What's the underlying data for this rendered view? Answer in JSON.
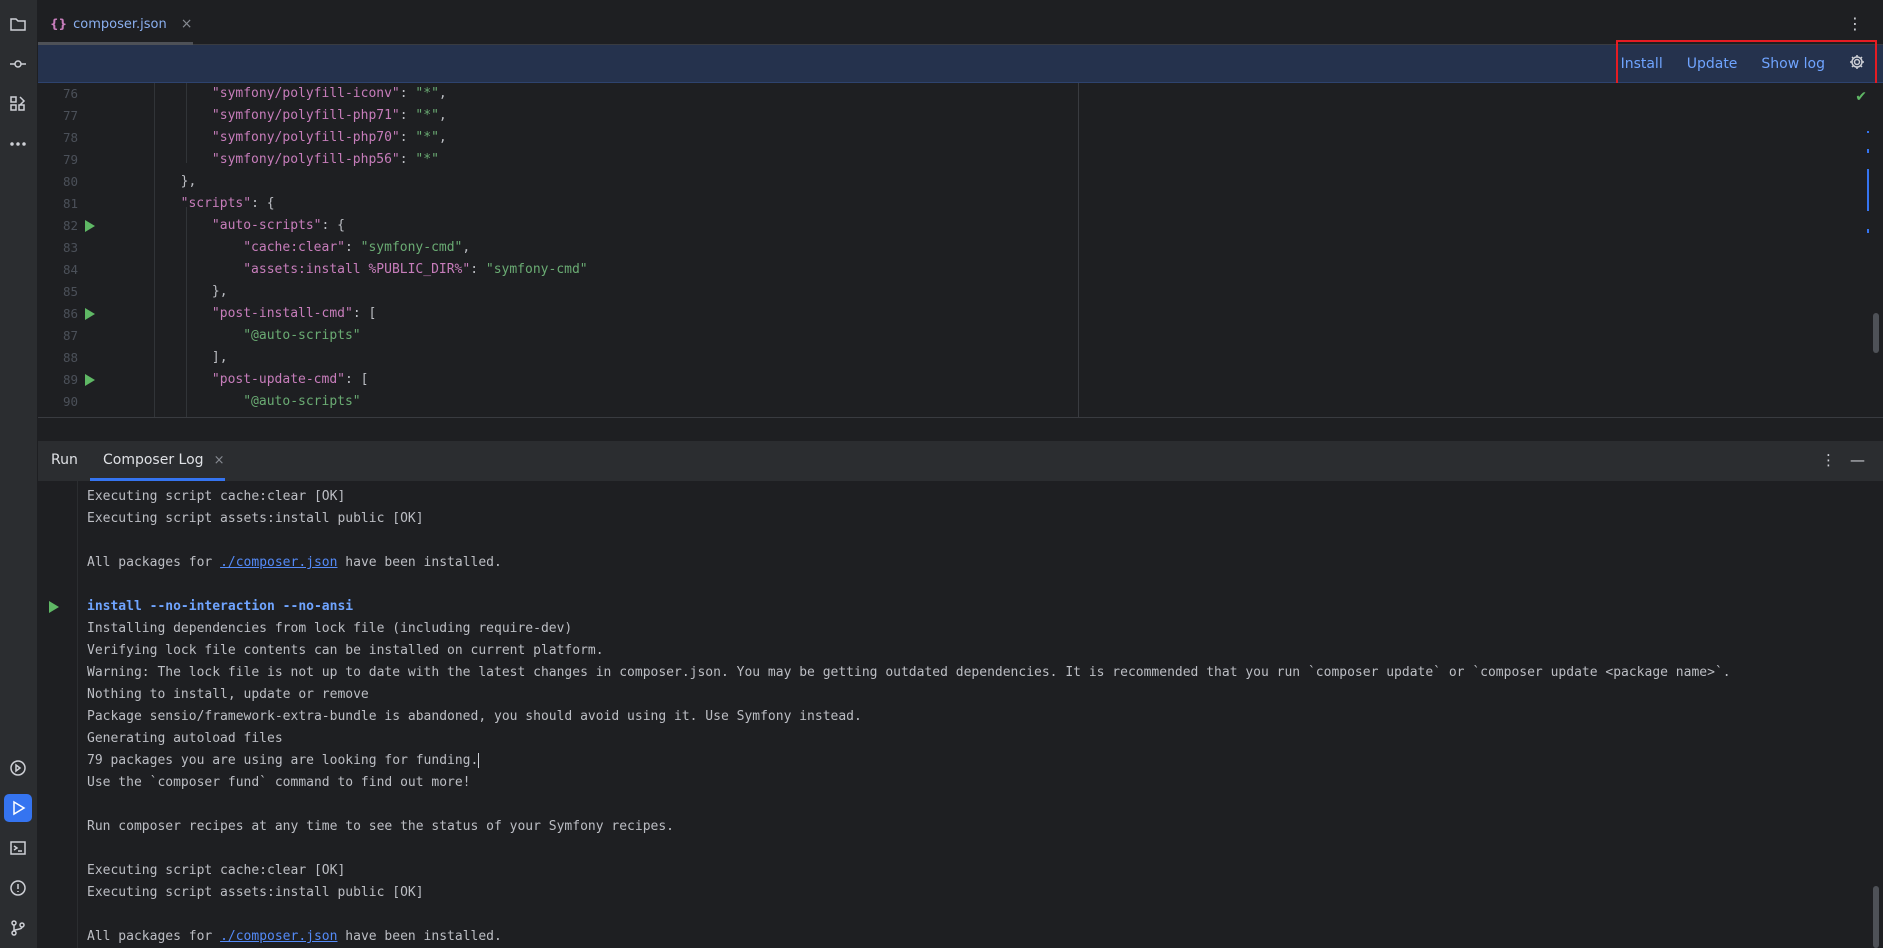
{
  "sidebar": {
    "top_icons": [
      {
        "icon": "folder-icon"
      },
      {
        "icon": "commit-icon"
      },
      {
        "icon": "structure-icon"
      },
      {
        "icon": "more-icon"
      }
    ],
    "bottom_icons": [
      {
        "icon": "services-icon"
      },
      {
        "icon": "run-icon",
        "active": true
      },
      {
        "icon": "terminal-icon"
      },
      {
        "icon": "problems-icon"
      },
      {
        "icon": "git-icon"
      }
    ]
  },
  "editor_tab": {
    "icon_text": "{}",
    "filename": "composer.json",
    "close": "×"
  },
  "notification_bar": {
    "install": "Install",
    "update": "Update",
    "show_log": "Show log"
  },
  "code_lines": [
    {
      "num": "76",
      "indent": "            ",
      "key": "\"symfony/polyfill-iconv\"",
      "sep": ": ",
      "val": "\"*\"",
      "tail": ","
    },
    {
      "num": "77",
      "indent": "            ",
      "key": "\"symfony/polyfill-php71\"",
      "sep": ": ",
      "val": "\"*\"",
      "tail": ","
    },
    {
      "num": "78",
      "indent": "            ",
      "key": "\"symfony/polyfill-php70\"",
      "sep": ": ",
      "val": "\"*\"",
      "tail": ","
    },
    {
      "num": "79",
      "indent": "            ",
      "key": "\"symfony/polyfill-php56\"",
      "sep": ": ",
      "val": "\"*\"",
      "tail": ""
    },
    {
      "num": "80",
      "indent": "        ",
      "key": "",
      "sep": "",
      "val": "",
      "tail": "},"
    },
    {
      "num": "81",
      "indent": "        ",
      "key": "\"scripts\"",
      "sep": ": ",
      "val": "",
      "tail": "{"
    },
    {
      "num": "82",
      "indent": "            ",
      "key": "\"auto-scripts\"",
      "sep": ": ",
      "val": "",
      "tail": "{",
      "run": true
    },
    {
      "num": "83",
      "indent": "                ",
      "key": "\"cache:clear\"",
      "sep": ": ",
      "val": "\"symfony-cmd\"",
      "tail": ","
    },
    {
      "num": "84",
      "indent": "                ",
      "key": "\"assets:install %PUBLIC_DIR%\"",
      "sep": ": ",
      "val": "\"symfony-cmd\"",
      "tail": ""
    },
    {
      "num": "85",
      "indent": "            ",
      "key": "",
      "sep": "",
      "val": "",
      "tail": "},"
    },
    {
      "num": "86",
      "indent": "            ",
      "key": "\"post-install-cmd\"",
      "sep": ": ",
      "val": "",
      "tail": "[",
      "run": true
    },
    {
      "num": "87",
      "indent": "                ",
      "key": "",
      "sep": "",
      "val": "\"@auto-scripts\"",
      "tail": ""
    },
    {
      "num": "88",
      "indent": "            ",
      "key": "",
      "sep": "",
      "val": "",
      "tail": "],"
    },
    {
      "num": "89",
      "indent": "            ",
      "key": "\"post-update-cmd\"",
      "sep": ": ",
      "val": "",
      "tail": "[",
      "run": true
    },
    {
      "num": "90",
      "indent": "                ",
      "key": "",
      "sep": "",
      "val": "\"@auto-scripts\"",
      "tail": ""
    }
  ],
  "panel": {
    "tab_run": "Run",
    "tab_composer_log": "Composer Log",
    "close": "×"
  },
  "console_lines": [
    {
      "text": "Executing script cache:clear [OK]"
    },
    {
      "text": "Executing script assets:install public [OK]"
    },
    {
      "text": ""
    },
    {
      "pre": "All packages for ",
      "link": "./composer.json",
      "post": " have been installed."
    },
    {
      "text": ""
    },
    {
      "text": "install --no-interaction --no-ansi",
      "cmd": true
    },
    {
      "text": "Installing dependencies from lock file (including require-dev)"
    },
    {
      "text": "Verifying lock file contents can be installed on current platform."
    },
    {
      "text": "Warning: The lock file is not up to date with the latest changes in composer.json. You may be getting outdated dependencies. It is recommended that you run `composer update` or `composer update <package name>`."
    },
    {
      "text": "Nothing to install, update or remove"
    },
    {
      "text": "Package sensio/framework-extra-bundle is abandoned, you should avoid using it. Use Symfony instead."
    },
    {
      "text": "Generating autoload files"
    },
    {
      "text": "79 packages you are using are looking for funding.",
      "caret": true
    },
    {
      "text": "Use the `composer fund` command to find out more!"
    },
    {
      "text": ""
    },
    {
      "text": "Run composer recipes at any time to see the status of your Symfony recipes."
    },
    {
      "text": ""
    },
    {
      "text": "Executing script cache:clear [OK]"
    },
    {
      "text": "Executing script assets:install public [OK]"
    },
    {
      "text": ""
    },
    {
      "pre": "All packages for ",
      "link": "./composer.json",
      "post": " have been installed."
    }
  ],
  "colors": {
    "accent": "#3574f0",
    "link": "#6fa4ff",
    "string_key": "#c77dbb",
    "string_value": "#6aab73",
    "run_green": "#5fb865",
    "highlight_red": "#e51c23"
  }
}
